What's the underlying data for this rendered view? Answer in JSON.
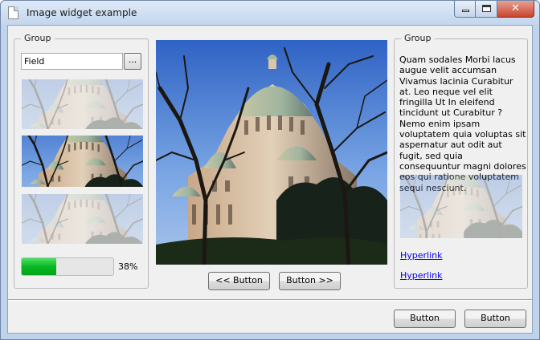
{
  "window": {
    "title": "Image widget example",
    "controls": {
      "minimize": "minimize-icon",
      "maximize": "maximize-icon",
      "close": "close-icon",
      "close_glyph": "✕"
    }
  },
  "left_group": {
    "title": "Group",
    "field_value": "Field",
    "browse_label": "...",
    "progress": {
      "percent": 38,
      "label": "38%"
    }
  },
  "center": {
    "prev_label": "<< Button",
    "next_label": "Button >>"
  },
  "right_group": {
    "title": "Group",
    "text": "Quam sodales Morbi lacus augue velit accumsan Vivamus lacinia Curabitur at. Leo neque vel elit fringilla Ut In eleifend tincidunt ut Curabitur ? Nemo enim ipsam voluptatem quia voluptas sit aspernatur aut odit aut fugit, sed quia consequuntur magni dolores eos qui ratione voluptatem sequi nesciunt.",
    "link1": "Hyperlink",
    "link2": "Hyperlink"
  },
  "footer": {
    "button1": "Button",
    "button2": "Button"
  },
  "colors": {
    "progress_fill": "#07b821",
    "link": "#0000ee",
    "sky": "#4f86d6"
  }
}
